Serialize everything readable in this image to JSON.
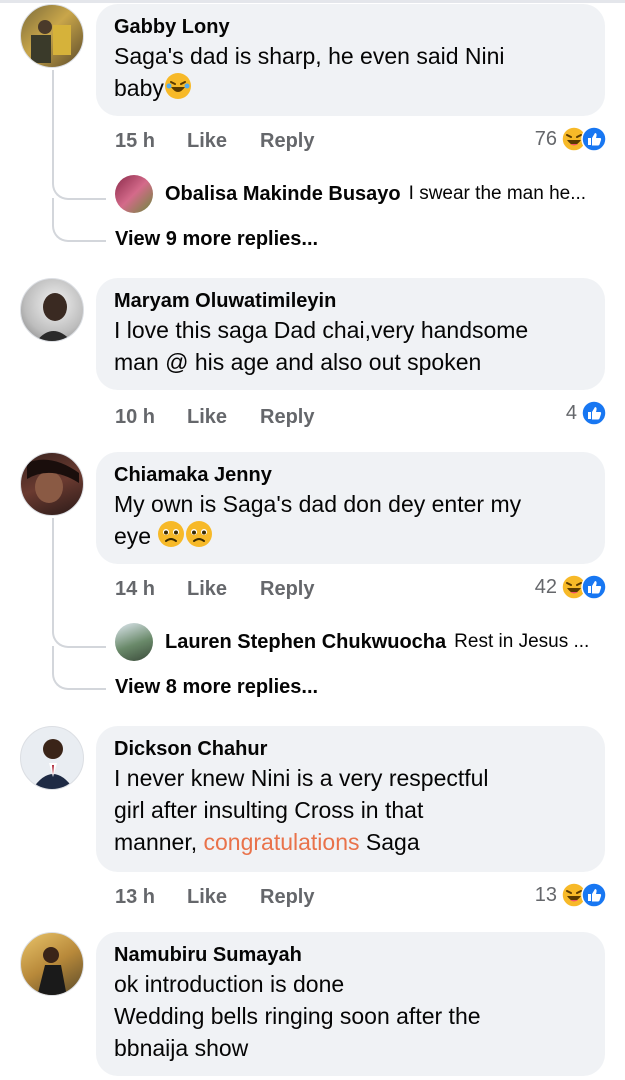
{
  "comments": [
    {
      "author": "Gabby Lony",
      "text_line1": "Saga's dad is sharp, he even said Nini",
      "text_line2": "baby",
      "time": "15 h",
      "like": "Like",
      "reply": "Reply",
      "reaction_count": "76",
      "reactions": [
        "laughing-emoji",
        "like-thumb-icon"
      ],
      "reply_preview": {
        "name": "Obalisa Makinde Busayo",
        "text": "I swear the man he..."
      },
      "more_replies": "View 9 more replies..."
    },
    {
      "author": "Maryam Oluwatimileyin",
      "text_line1": "I love this saga Dad chai,very handsome",
      "text_line2": "man @ his age and also out spoken",
      "time": "10 h",
      "like": "Like",
      "reply": "Reply",
      "reaction_count": "4",
      "reactions": [
        "like-thumb-icon"
      ]
    },
    {
      "author": "Chiamaka Jenny",
      "text_line1": "My own is Saga's dad don dey enter my",
      "text_line2": "eye",
      "time": "14 h",
      "like": "Like",
      "reply": "Reply",
      "reaction_count": "42",
      "reactions": [
        "laughing-emoji",
        "like-thumb-icon"
      ],
      "reply_preview": {
        "name": "Lauren Stephen Chukwuocha",
        "text": "Rest in Jesus ..."
      },
      "more_replies": "View 8 more replies..."
    },
    {
      "author": "Dickson Chahur",
      "text_line1": "I never knew Nini is a very respectful",
      "text_line2": "girl after insulting Cross in that",
      "text_line3a": "manner, ",
      "text_line3_link": "congratulations",
      "text_line3b": " Saga",
      "time": "13 h",
      "like": "Like",
      "reply": "Reply",
      "reaction_count": "13",
      "reactions": [
        "laughing-emoji",
        "like-thumb-icon"
      ]
    },
    {
      "author": "Namubiru Sumayah",
      "text_line1": "ok introduction is done",
      "text_line2": "Wedding bells ringing soon after the",
      "text_line3": "bbnaija show"
    }
  ],
  "colors": {
    "bubble": "#f0f2f5",
    "meta_text": "#65676b",
    "like_blue": "#1877f2",
    "emoji_yellow": "#f7b928",
    "link_orange": "#e9724a"
  }
}
